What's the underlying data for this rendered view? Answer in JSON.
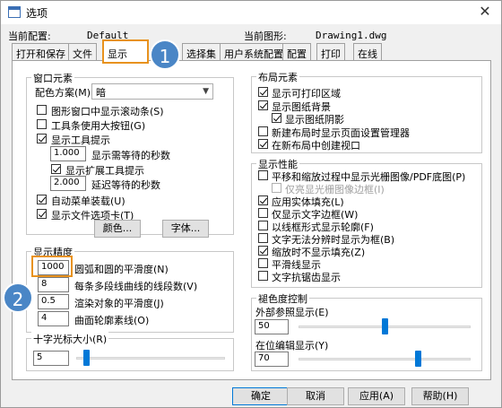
{
  "window": {
    "title": "选项",
    "close_glyph": "✕"
  },
  "header": {
    "current_profile_label": "当前配置:",
    "current_profile_value": "Default",
    "current_drawing_label": "当前图形:",
    "current_drawing_value": "Drawing1.dwg"
  },
  "tabs": [
    "打开和保存",
    "文件",
    "显示",
    "选择集",
    "用户系统配置",
    "配置",
    "打印",
    "在线"
  ],
  "window_elements": {
    "title": "窗口元素",
    "color_scheme_label": "配色方案(M)",
    "color_scheme_value": "暗",
    "scrollbars": "图形窗口中显示滚动条(S)",
    "large_buttons": "工具条使用大按钮(G)",
    "tooltips": "显示工具提示",
    "tooltip_delay_value": "1.000",
    "tooltip_delay_label": "显示需等待的秒数",
    "ext_tooltips": "显示扩展工具提示",
    "ext_delay_value": "2.000",
    "ext_delay_label": "延迟等待的秒数",
    "auto_menu": "自动菜单装载(U)",
    "file_tabs": "显示文件选项卡(T)",
    "colors_button": "颜色...",
    "fonts_button": "字体..."
  },
  "precision": {
    "title": "显示精度",
    "arc_value": "1000",
    "arc_label": "圆弧和圆的平滑度(N)",
    "polyline_value": "8",
    "polyline_label": "每条多段线曲线的线段数(V)",
    "render_value": "0.5",
    "render_label": "渲染对象的平滑度(J)",
    "contour_value": "4",
    "contour_label": "曲面轮廓素线(O)"
  },
  "crosshair": {
    "title": "十字光标大小(R)",
    "value": "5",
    "level_fraction": 0.05
  },
  "layout_elements": {
    "title": "布局元素",
    "printable_area": "显示可打印区域",
    "paper_bg": "显示图纸背景",
    "paper_shadow": "显示图纸阴影",
    "page_setup": "新建布局时显示页面设置管理器",
    "create_viewport": "在新布局中创建视口"
  },
  "performance": {
    "title": "显示性能",
    "pan_zoom": "平移和缩放过程中显示光栅图像/PDF底图(P)",
    "raster_frame": "仅亮显光栅图像边框(I)",
    "solid_fill": "应用实体填充(L)",
    "text_frame": "仅显示文字边框(W)",
    "wireframe": "以线框形式显示轮廓(F)",
    "text_unreadable": "文字无法分辨时显示为框(B)",
    "no_fill_zoom": "缩放时不显示填充(Z)",
    "lineweight": "平滑线显示",
    "text_aa": "文字抗锯齿显示"
  },
  "fade": {
    "title": "褪色度控制",
    "xref_label": "外部参照显示(E)",
    "xref_value": "50",
    "xref_fraction": 0.5,
    "inplace_label": "在位编辑显示(Y)",
    "inplace_value": "70",
    "inplace_fraction": 0.7
  },
  "buttons": {
    "ok": "确定",
    "cancel": "取消",
    "apply": "应用(A)",
    "help": "帮助(H)"
  },
  "annotations": {
    "marker1": "1",
    "marker2": "2"
  }
}
